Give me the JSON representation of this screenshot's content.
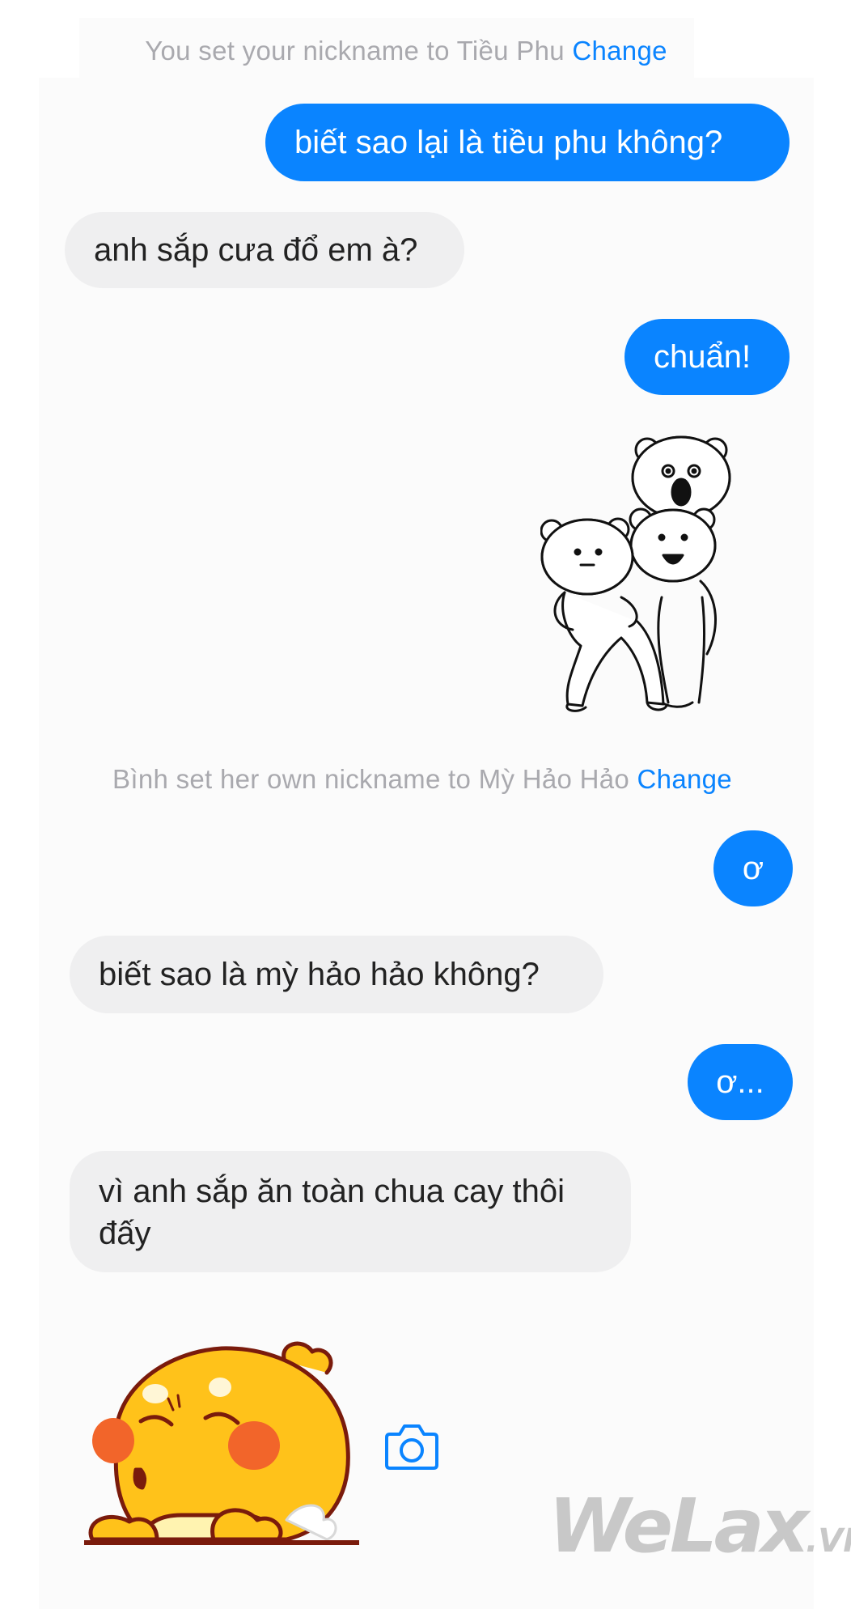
{
  "system_notices": [
    {
      "prefix": "You set your nickname to Tiều Phu ",
      "link": "Change"
    },
    {
      "prefix": "Bình set her own nickname to Mỳ Hảo Hảo ",
      "link": "Change"
    }
  ],
  "messages": [
    {
      "side": "outgoing",
      "text": "biết sao lại là tiều phu không?"
    },
    {
      "side": "incoming",
      "text": "anh sắp cưa đổ em à?"
    },
    {
      "side": "outgoing",
      "text": "chuẩn!"
    },
    {
      "side": "outgoing",
      "text": "ơ"
    },
    {
      "side": "incoming",
      "text": "biết sao là mỳ hảo hảo không?"
    },
    {
      "side": "outgoing",
      "text": "ơ..."
    },
    {
      "side": "incoming",
      "text": "vì anh sắp ăn toàn chua cay thôi đấy"
    }
  ],
  "stickers": {
    "bears": "dancing-bears-sticker",
    "chick": "yellow-chick-sticker"
  },
  "icons": {
    "camera": "camera-icon"
  },
  "watermark": {
    "main": "WeLax",
    "suffix": ".VN"
  },
  "colors": {
    "accent": "#0a84ff",
    "incoming_bubble": "#efeff0",
    "notice_text": "#a9a9ae"
  }
}
